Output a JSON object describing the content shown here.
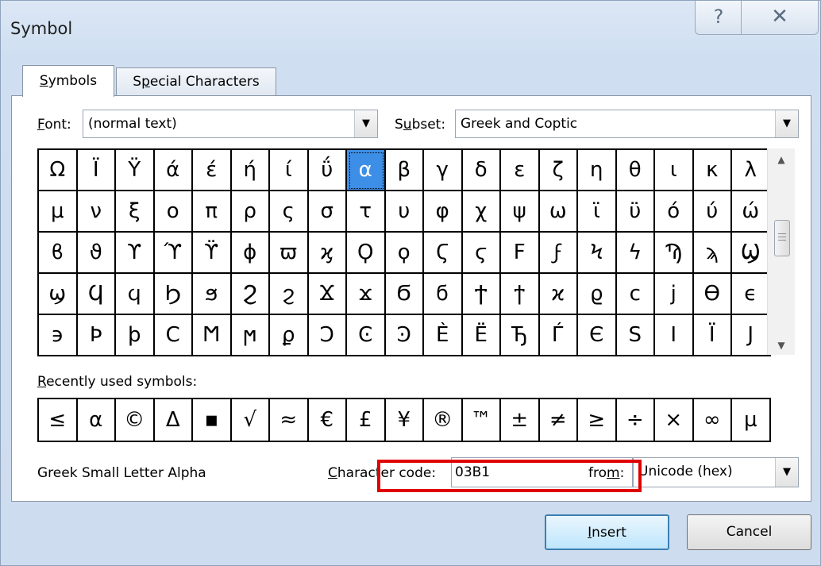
{
  "window": {
    "title": "Symbol",
    "help_glyph": "?",
    "close_glyph": "✕"
  },
  "tabs": {
    "symbols": {
      "label": "Symbols",
      "access": "S"
    },
    "special": {
      "label": "Special Characters",
      "access": "p"
    }
  },
  "font": {
    "label": "Font:",
    "access": "F",
    "value": "(normal text)"
  },
  "subset": {
    "label": "Subset:",
    "access": "u",
    "value": "Greek and Coptic"
  },
  "symbol_grid": {
    "rows": [
      [
        "Ω",
        "Ϊ",
        "Ϋ",
        "ά",
        "έ",
        "ή",
        "ί",
        "ΰ",
        "α",
        "β",
        "γ",
        "δ",
        "ε",
        "ζ",
        "η",
        "θ",
        "ι",
        "κ",
        "λ"
      ],
      [
        "μ",
        "ν",
        "ξ",
        "ο",
        "π",
        "ρ",
        "ς",
        "σ",
        "τ",
        "υ",
        "φ",
        "χ",
        "ψ",
        "ω",
        "ϊ",
        "ϋ",
        "ό",
        "ύ",
        "ώ"
      ],
      [
        "ϐ",
        "ϑ",
        "ϒ",
        "ϓ",
        "ϔ",
        "ϕ",
        "ϖ",
        "ϗ",
        "Ϙ",
        "ϙ",
        "Ϛ",
        "ϛ",
        "Ϝ",
        "ϝ",
        "Ϟ",
        "ϟ",
        "Ϡ",
        "ϡ",
        "Ϣ"
      ],
      [
        "ϣ",
        "Ϥ",
        "ϥ",
        "Ϧ",
        "ϧ",
        "Ϩ",
        "ϩ",
        "Ϫ",
        "ϫ",
        "Ϭ",
        "ϭ",
        "Ϯ",
        "ϯ",
        "ϰ",
        "ϱ",
        "ϲ",
        "ϳ",
        "ϴ",
        "ϵ"
      ],
      [
        "϶",
        "Ϸ",
        "ϸ",
        "Ϲ",
        "Ϻ",
        "ϻ",
        "ϼ",
        "Ͻ",
        "Ͼ",
        "Ͽ",
        "Ѐ",
        "Ё",
        "Ђ",
        "Ѓ",
        "Є",
        "Ѕ",
        "І",
        "Ї",
        "Ј"
      ]
    ],
    "selected": {
      "row": 0,
      "col": 8
    }
  },
  "recent": {
    "label": "Recently used symbols:",
    "access": "R",
    "symbols": [
      "≤",
      "α",
      "©",
      "Δ",
      "▪",
      "√",
      "≈",
      "€",
      "£",
      "¥",
      "®",
      "™",
      "±",
      "≠",
      "≥",
      "÷",
      "×",
      "∞",
      "µ"
    ]
  },
  "character_name": "Greek Small Letter Alpha",
  "character_code": {
    "label": "Character code:",
    "access": "C",
    "value": "03B1"
  },
  "from": {
    "label": "from:",
    "access": "m",
    "value": "Unicode (hex)"
  },
  "buttons": {
    "insert": "Insert",
    "insert_access": "I",
    "cancel": "Cancel"
  },
  "highlight_color": "#e00000",
  "selection_color": "#3d8ee6"
}
